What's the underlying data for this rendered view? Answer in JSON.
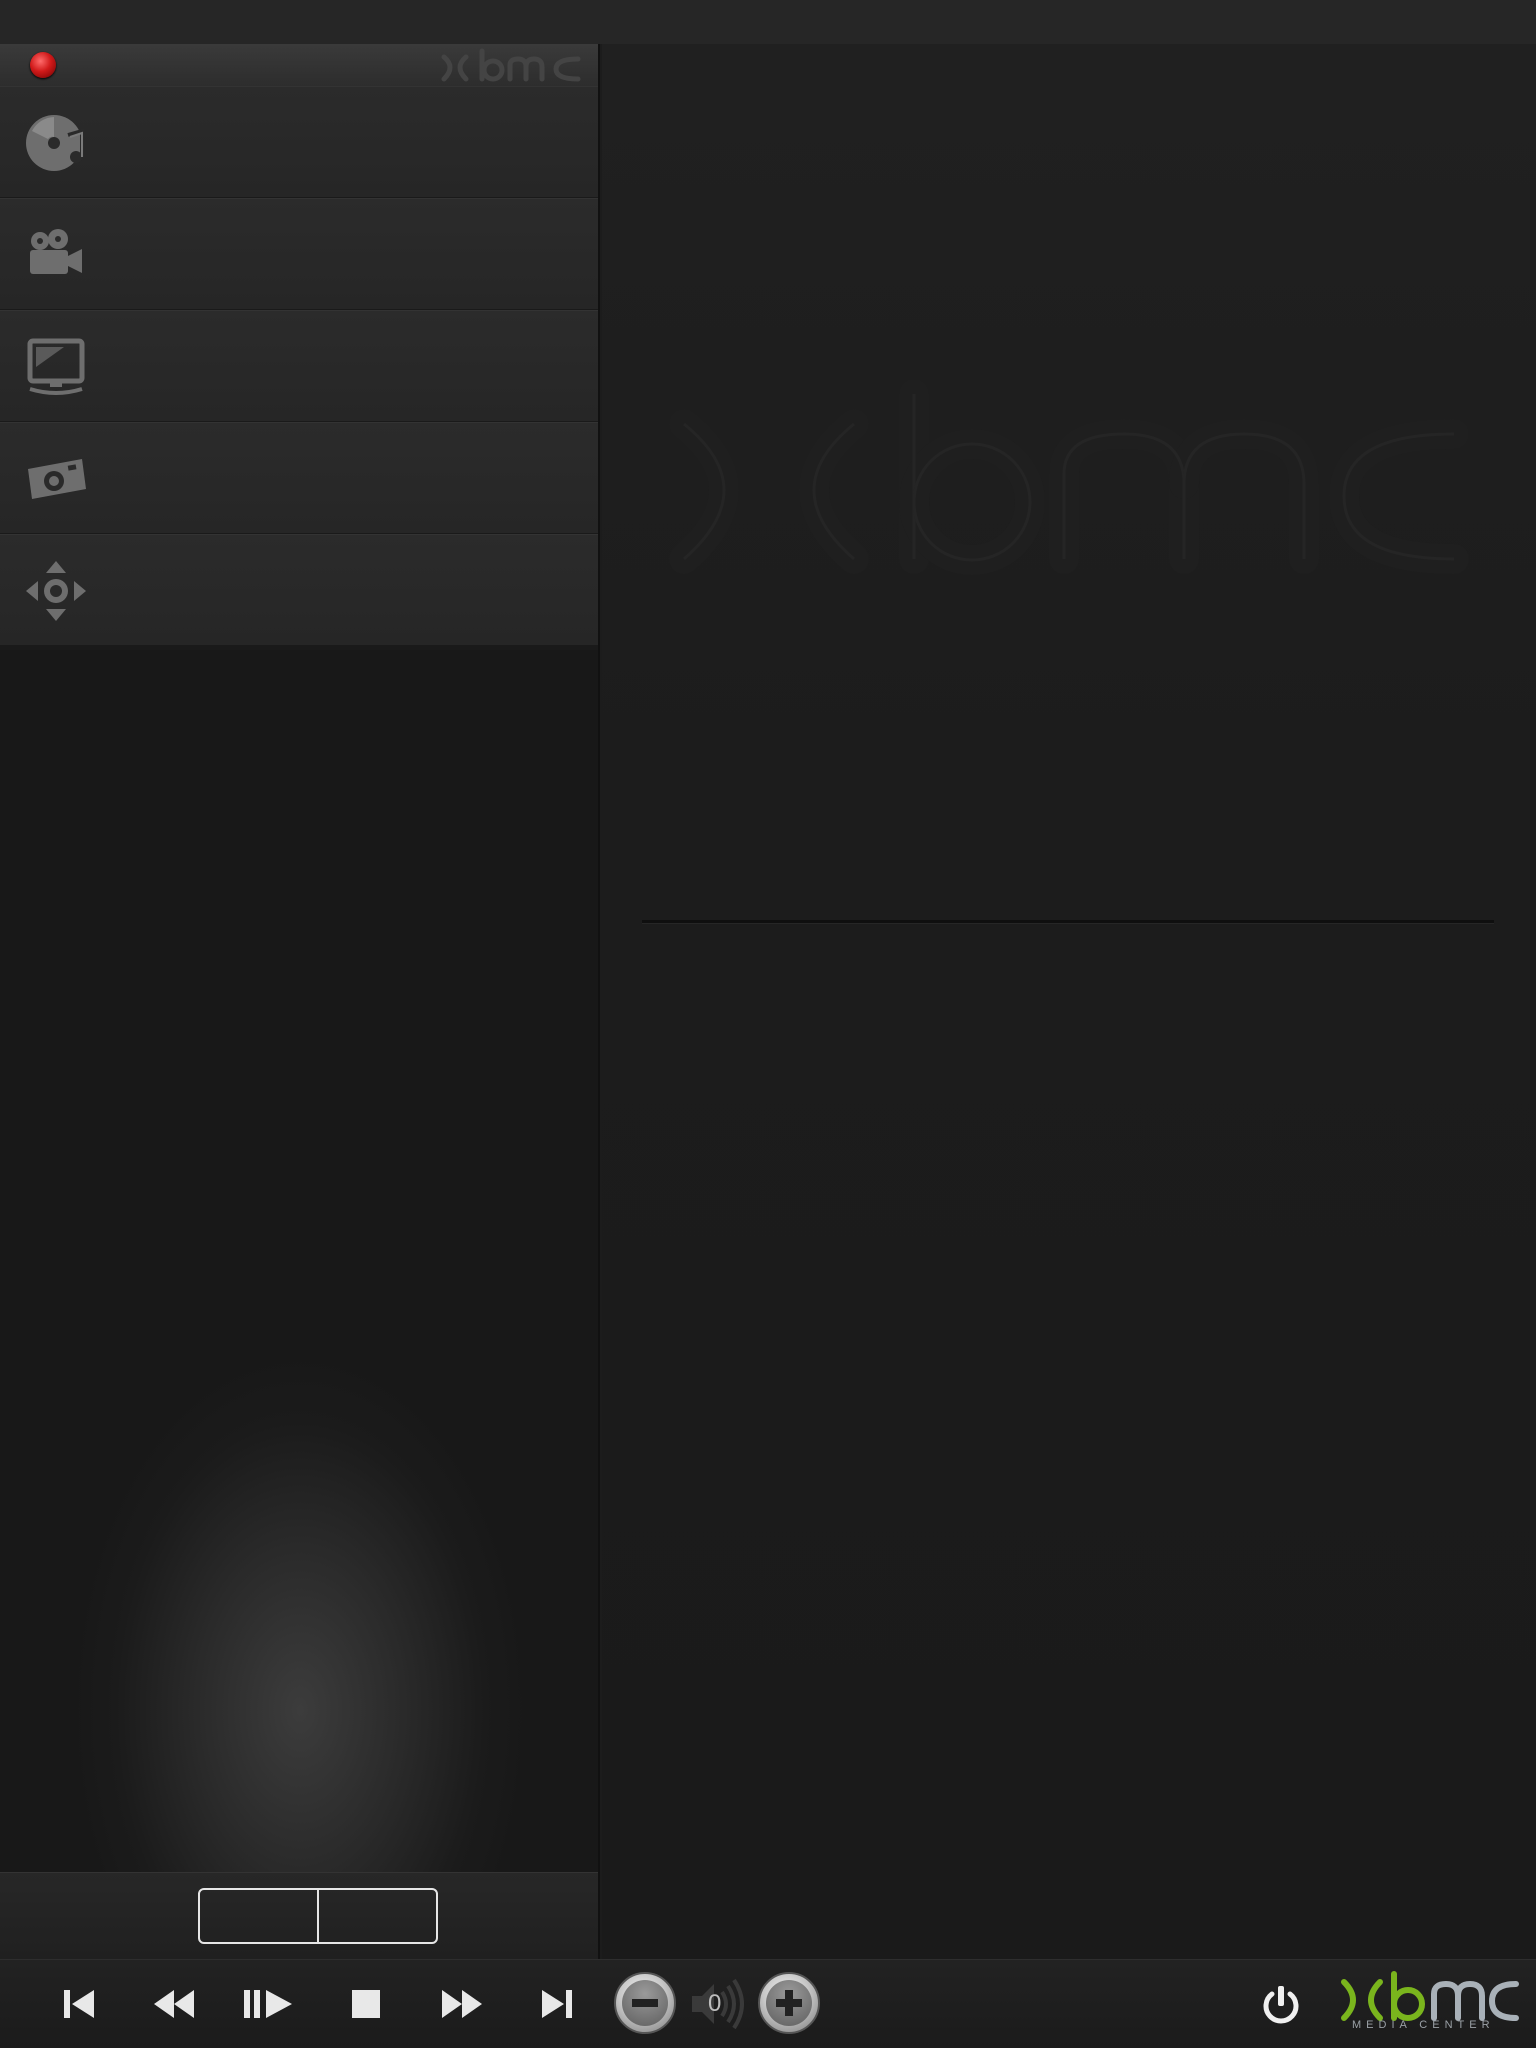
{
  "app": {
    "name": "xbmc",
    "connection_status": "disconnected",
    "status_color": "#d11a1a"
  },
  "sidebar": {
    "header_logo": "xbmc",
    "menu_items": [
      {
        "id": "music",
        "icon": "music-disc-icon"
      },
      {
        "id": "movies",
        "icon": "movie-camera-icon"
      },
      {
        "id": "tv",
        "icon": "tv-monitor-icon"
      },
      {
        "id": "pictures",
        "icon": "photo-camera-icon"
      },
      {
        "id": "remote",
        "icon": "dpad-remote-icon"
      }
    ],
    "footer_segments": [
      "",
      ""
    ]
  },
  "main": {
    "watermark": "xbmc"
  },
  "transport": {
    "buttons": [
      "previous-icon",
      "rewind-icon",
      "play-pause-icon",
      "stop-icon",
      "fast-forward-icon",
      "next-icon"
    ]
  },
  "volume": {
    "value": "0"
  },
  "brand": {
    "logo": "xbmc",
    "subtitle": "MEDIA CENTER",
    "accent": "#7ab51d",
    "secondary": "#a9b1b8"
  }
}
